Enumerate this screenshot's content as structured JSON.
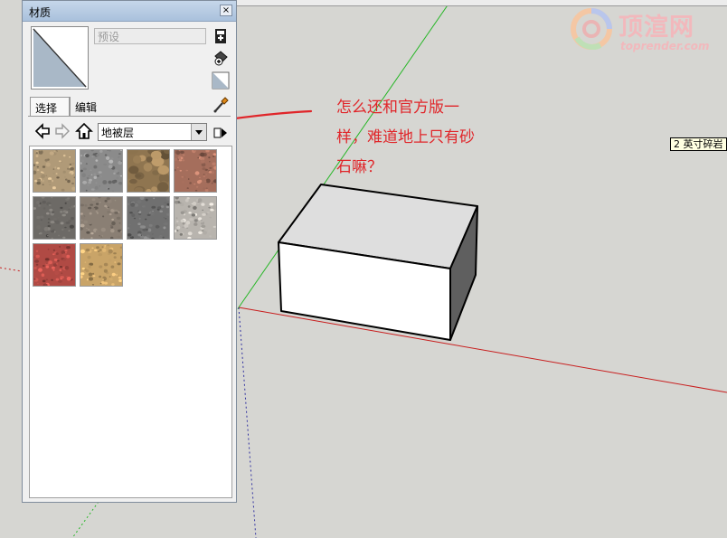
{
  "panel": {
    "title": "材质",
    "close_glyph": "×",
    "preset_name": "预设",
    "tabs": [
      {
        "label": "选择",
        "active": true
      },
      {
        "label": "编辑",
        "active": false
      }
    ],
    "library_selected": "地被层",
    "icons": {
      "back": "back-arrow-icon",
      "forward": "forward-arrow-icon",
      "home": "home-icon",
      "details": "details-arrow-icon",
      "create": "create-material-icon",
      "paint": "paint-bucket-icon",
      "default": "default-material-icon",
      "sample": "eyedropper-icon"
    },
    "swatches": [
      {
        "name": "gravel-tan",
        "color": "#b09a78"
      },
      {
        "name": "gravel-gray",
        "color": "#8b8b8b"
      },
      {
        "name": "river-pebbles",
        "color": "#8f7550"
      },
      {
        "name": "gravel-red-brown",
        "color": "#a56e5c"
      },
      {
        "name": "crushed-stone-dark",
        "color": "#6d6a66"
      },
      {
        "name": "gravel-brown-gray",
        "color": "#8a7f74"
      },
      {
        "name": "gravel-dark-gray",
        "color": "#707070"
      },
      {
        "name": "stone-light-gray",
        "color": "#b8b4ae"
      },
      {
        "name": "red-ground",
        "color": "#b04a44"
      },
      {
        "name": "sand",
        "color": "#c9a468"
      }
    ]
  },
  "tooltip": "2 英寸碎岩",
  "annotation": {
    "lines": [
      "怎么还和官方版一",
      "样，难道地上只有砂",
      "石嘛？"
    ],
    "color": "#e0262a"
  },
  "watermark": {
    "title": "顶渲网",
    "subtitle": "toprender.com"
  },
  "colors": {
    "green_axis": "#25b625",
    "red_axis": "#c81e1e",
    "blue_axis": "#3030a0",
    "background": "#d6d6d2"
  }
}
